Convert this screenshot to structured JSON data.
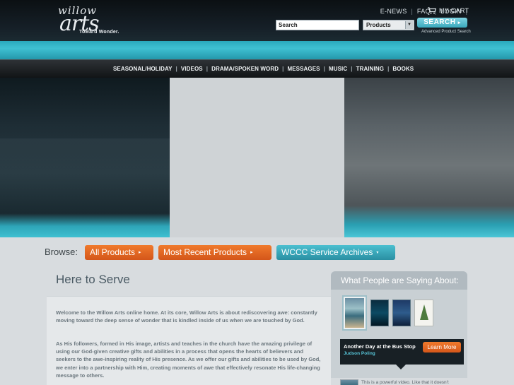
{
  "header": {
    "logo": {
      "line1": "willow",
      "line2": "arts",
      "tagline": "Toward Wonder."
    },
    "top_links": [
      "E-NEWS",
      "FAQ",
      "LOGIN"
    ],
    "cart_label": "MY CART",
    "search": {
      "value": "Search",
      "category": "Products",
      "button": "SEARCH",
      "button_arrow": "▸",
      "advanced": "Advanced Product Search"
    }
  },
  "nav": {
    "items": [
      "SEASONAL/HOLIDAY",
      "VIDEOS",
      "DRAMA/SPOKEN WORD",
      "MESSAGES",
      "MUSIC",
      "TRAINING",
      "BOOKS"
    ],
    "separator": "|"
  },
  "browse": {
    "label": "Browse:",
    "buttons": [
      {
        "label": "All Products",
        "arrow": "▸"
      },
      {
        "label": "Most Recent Products",
        "arrow": "▸"
      },
      {
        "label": "WCCC Service Archives",
        "arrow": "▾"
      }
    ]
  },
  "main": {
    "title": "Here to Serve",
    "paragraphs": [
      "Welcome to the Willow Arts online home. At its core, Willow Arts is about rediscovering awe: constantly moving toward the deep sense of wonder that is kindled inside of us when we are touched by God.",
      "As His followers, formed in His image, artists and teaches in the church have the amazing privilege of using our God-given creative gifts and abilities in a process that opens the hearts of believers and seekers to the awe-inspiring reality of His presence. As we offer our gifts and abilities to be used by God, we enter into a partnership with Him, creating moments of awe that effectively resonate His life-changing message to others."
    ]
  },
  "sidebar": {
    "heading": "What People are Saying About:",
    "featured": {
      "title": "Another Day at the Bus Stop",
      "author": "Judson Poling",
      "button": "Learn More"
    },
    "quote": "This is a powerful video. Like that it doesn't"
  },
  "colors": {
    "accent_teal": "#3fc0d2",
    "accent_orange": "#e0661f",
    "nav_bg": "#1a1e21"
  }
}
